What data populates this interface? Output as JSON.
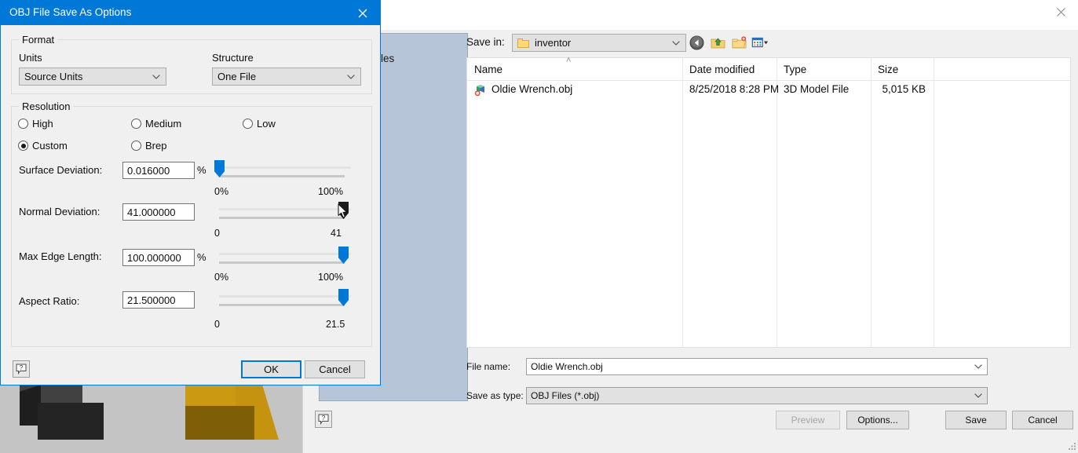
{
  "colors": {
    "accent": "#0078d7",
    "dialog_bg": "#f0f0f0",
    "viewport_bg": "#c4c4c4",
    "center_panel_bg": "#b6c5d8",
    "slider_thumb": "#0078d7",
    "slider_thumb_active": "#1a1a1a",
    "model_dark": "#242424",
    "model_gold": "#cc9a12"
  },
  "viewport": {
    "name": "3d-model-viewport"
  },
  "main_window": {
    "close_label": "✕",
    "background_panel_label": ": Center Files"
  },
  "file_browser": {
    "save_in": {
      "label": "Save in:",
      "value": "inventor"
    },
    "toolbar": [
      {
        "name": "back-icon",
        "title": "Back"
      },
      {
        "name": "up-folder-icon",
        "title": "Up One Level"
      },
      {
        "name": "new-folder-icon",
        "title": "Create New Folder"
      },
      {
        "name": "views-icon",
        "title": "Views"
      }
    ],
    "columns": [
      "Name",
      "Date modified",
      "Type",
      "Size"
    ],
    "sort_indicator": "˄",
    "rows": [
      {
        "name": "Oldie Wrench.obj",
        "date_modified": "8/25/2018 8:28 PM",
        "type": "3D Model File",
        "size": "5,015 KB"
      }
    ],
    "file_name": {
      "label": "File name:",
      "value": "Oldie Wrench.obj"
    },
    "save_as_type": {
      "label": "Save as type:",
      "value": "OBJ Files (*.obj)"
    },
    "buttons": {
      "preview": "Preview",
      "options": "Options...",
      "save": "Save",
      "cancel": "Cancel"
    },
    "help_icon": "?"
  },
  "options_dialog": {
    "title": "OBJ File Save As Options",
    "close_label": "✕",
    "format": {
      "group_title": "Format",
      "units_label": "Units",
      "units_value": "Source Units",
      "structure_label": "Structure",
      "structure_value": "One File"
    },
    "resolution": {
      "group_title": "Resolution",
      "options": [
        {
          "label": "High",
          "checked": false
        },
        {
          "label": "Medium",
          "checked": false
        },
        {
          "label": "Low",
          "checked": false
        },
        {
          "label": "Custom",
          "checked": true
        },
        {
          "label": "Brep",
          "checked": false
        }
      ],
      "sliders": [
        {
          "label": "Surface Deviation:",
          "value": "0.016000",
          "suffix": "%",
          "min_tick": "0%",
          "max_tick": "100%",
          "thumb_pct": 1,
          "dragging": false
        },
        {
          "label": "Normal Deviation:",
          "value": "41.000000",
          "suffix": "",
          "min_tick": "0",
          "max_tick": "41",
          "thumb_pct": 100,
          "dragging": true
        },
        {
          "label": "Max Edge Length:",
          "value": "100.000000",
          "suffix": "%",
          "min_tick": "0%",
          "max_tick": "100%",
          "thumb_pct": 100,
          "dragging": false
        },
        {
          "label": "Aspect Ratio:",
          "value": "21.500000",
          "suffix": "",
          "min_tick": "0",
          "max_tick": "21.5",
          "thumb_pct": 100,
          "dragging": false
        }
      ]
    },
    "buttons": {
      "ok": "OK",
      "cancel": "Cancel"
    },
    "help_icon": "?"
  }
}
